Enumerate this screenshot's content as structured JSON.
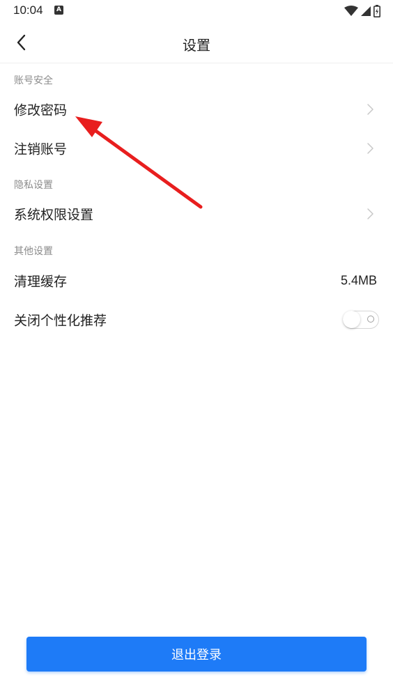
{
  "status_bar": {
    "time": "10:04",
    "icons": [
      "a-notification-icon",
      "wifi-icon",
      "signal-icon",
      "battery-charging-icon"
    ]
  },
  "header": {
    "title": "设置",
    "back_icon": "chevron-left-icon"
  },
  "sections": [
    {
      "label": "账号安全",
      "items": [
        {
          "label": "修改密码",
          "trailing": "chevron-right-icon"
        },
        {
          "label": "注销账号",
          "trailing": "chevron-right-icon"
        }
      ]
    },
    {
      "label": "隐私设置",
      "items": [
        {
          "label": "系统权限设置",
          "trailing": "chevron-right-icon"
        }
      ]
    },
    {
      "label": "其他设置",
      "items": [
        {
          "label": "清理缓存",
          "value": "5.4MB"
        },
        {
          "label": "关闭个性化推荐",
          "toggle_on": false
        }
      ]
    }
  ],
  "logout_button": {
    "label": "退出登录"
  },
  "colors": {
    "accent": "#1e7bf7",
    "annotation_arrow": "#e81e1e",
    "section_label": "#8c8c8c"
  }
}
